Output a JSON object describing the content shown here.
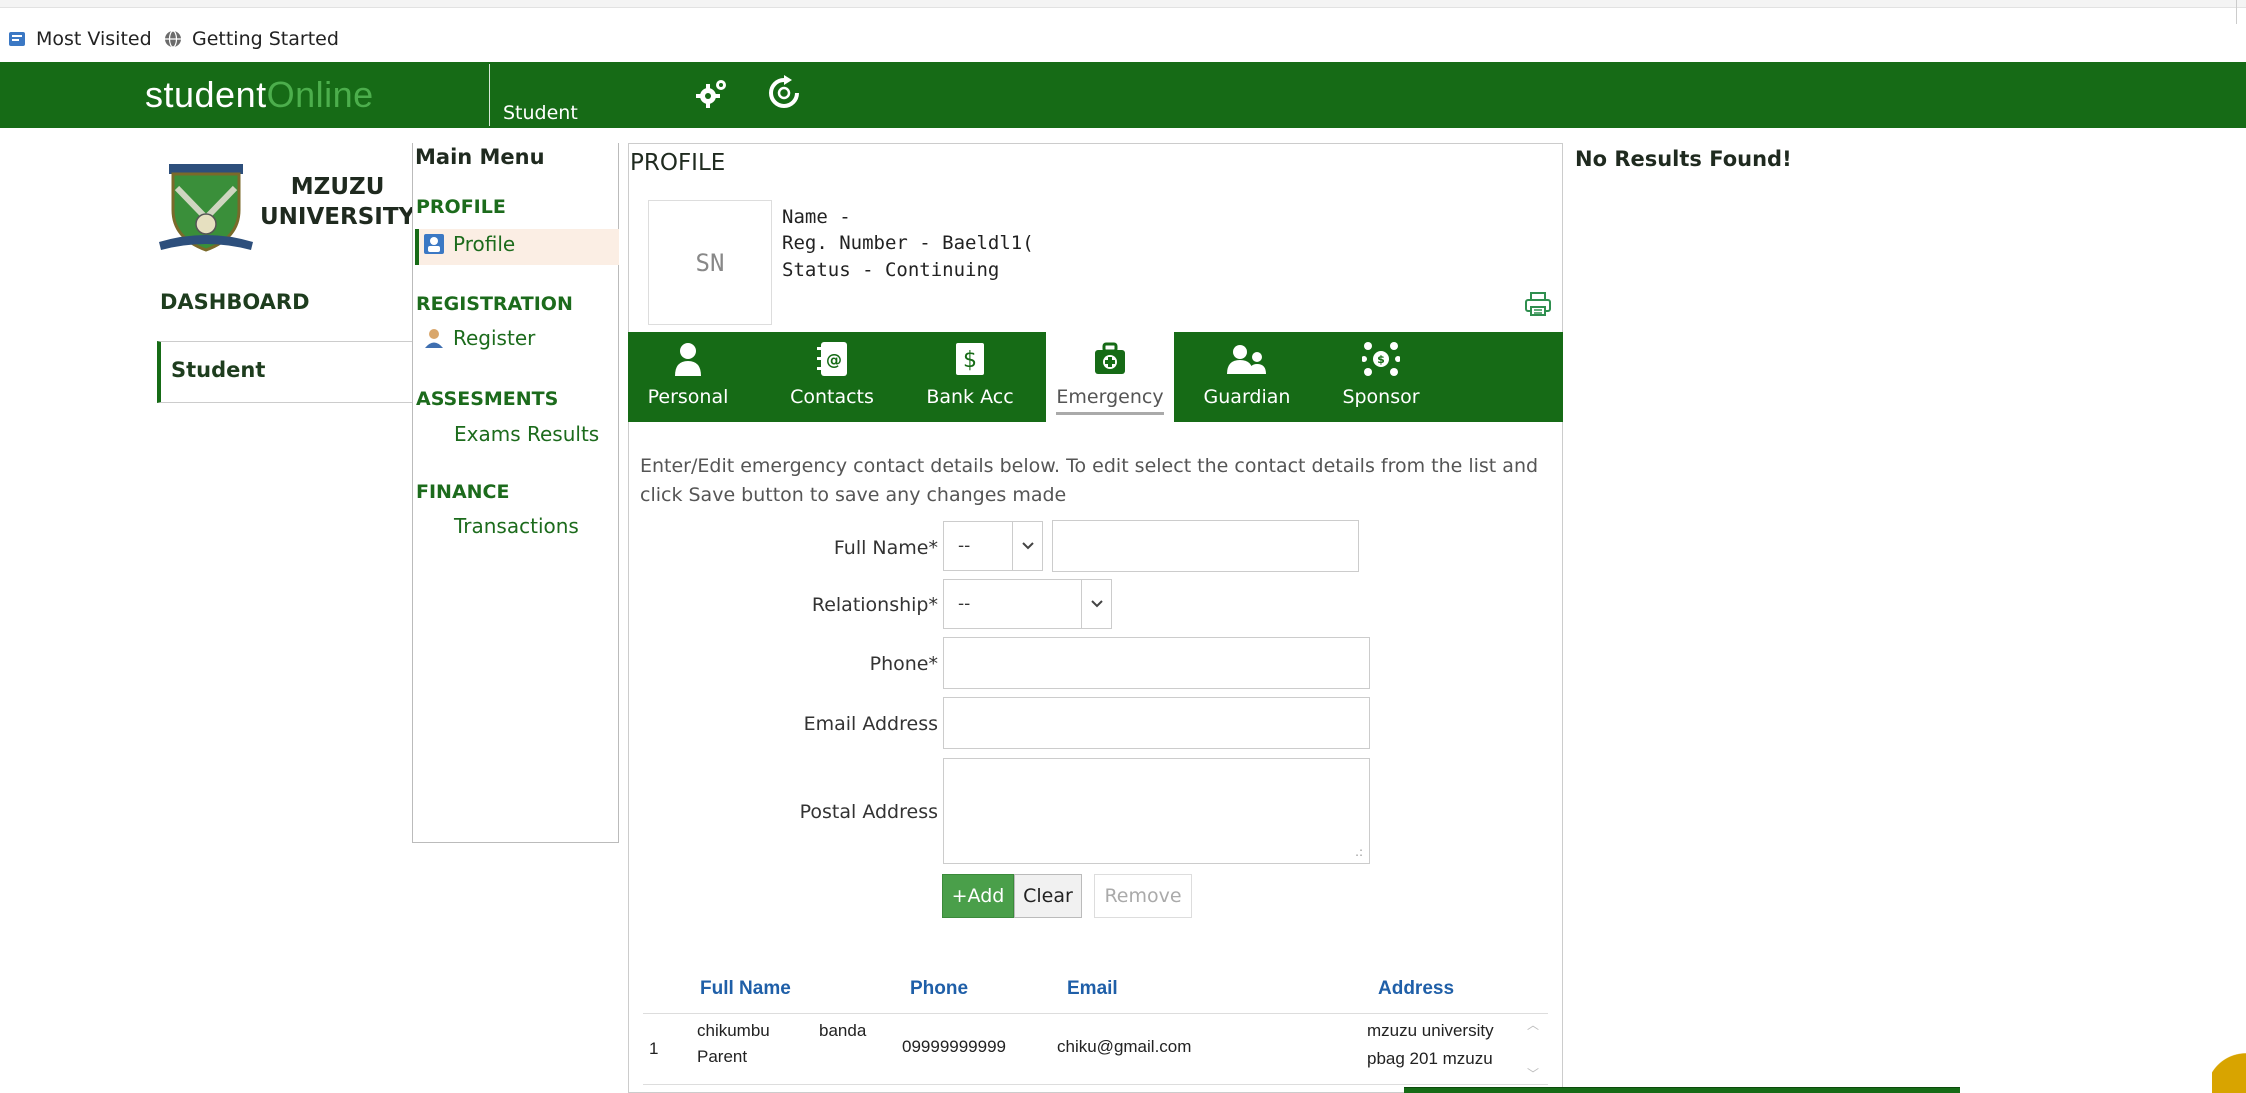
{
  "browser": {
    "bookmarks": [
      {
        "label": "Most Visited",
        "icon": "bookmark-folder-icon"
      },
      {
        "label": "Getting Started",
        "icon": "globe-icon"
      }
    ]
  },
  "header": {
    "brand_part1": "student",
    "brand_part2": "Online",
    "user_label": "Student",
    "icons": [
      "settings-gears-icon",
      "refresh-icon"
    ],
    "colors": {
      "primary": "#166b16",
      "brand_accent": "#4cae4c"
    }
  },
  "sidebar": {
    "university": {
      "line1": "MZUZU",
      "line2": "UNIVERSITY"
    },
    "dashboard_label": "DASHBOARD",
    "student_label": "Student"
  },
  "menu": {
    "title": "Main Menu",
    "sections": [
      {
        "title": "PROFILE",
        "items": [
          {
            "label": "Profile",
            "icon": "profile-card-icon",
            "active": true
          }
        ]
      },
      {
        "title": "REGISTRATION",
        "items": [
          {
            "label": "Register",
            "icon": "user-icon"
          }
        ]
      },
      {
        "title": "ASSESMENTS",
        "items": [
          {
            "label": "Exams Results"
          }
        ]
      },
      {
        "title": "FINANCE",
        "items": [
          {
            "label": "Transactions"
          }
        ]
      }
    ]
  },
  "profile": {
    "title": "PROFILE",
    "initials": "SN",
    "name_line": "Name -",
    "reg_line": "Reg. Number - Baeldl1(",
    "status_line": "Status - Continuing"
  },
  "tabs": [
    {
      "label": "Personal",
      "icon": "person-icon"
    },
    {
      "label": "Contacts",
      "icon": "address-book-icon"
    },
    {
      "label": "Bank Acc",
      "icon": "dollar-icon"
    },
    {
      "label": "Emergency",
      "icon": "first-aid-kit-icon",
      "active": true
    },
    {
      "label": "Guardian",
      "icon": "guardian-icon"
    },
    {
      "label": "Sponsor",
      "icon": "sponsor-icon"
    }
  ],
  "form": {
    "instructions": "Enter/Edit emergency contact details below. To edit select the contact details from the list and click Save button to save any changes made",
    "full_name_label": "Full Name*",
    "full_name_select": "--",
    "full_name_value": "",
    "relationship_label": "Relationship*",
    "relationship_select": "--",
    "phone_label": "Phone*",
    "phone_value": "",
    "email_label": "Email Address",
    "email_value": "",
    "postal_label": "Postal Address",
    "postal_value": "",
    "add_button": "+Add",
    "clear_button": "Clear",
    "remove_button": "Remove"
  },
  "table": {
    "headers": [
      "Full Name",
      "Phone",
      "Email",
      "Address"
    ],
    "rows": [
      {
        "index": "1",
        "name_line1": "chikumbu",
        "name_line1_b": "banda",
        "name_line2": "Parent",
        "phone": "09999999999",
        "email": "chiku@gmail.com",
        "address_line1": "mzuzu university",
        "address_line2": "pbag 201 mzuzu"
      }
    ]
  },
  "side_message": "No Results Found!"
}
